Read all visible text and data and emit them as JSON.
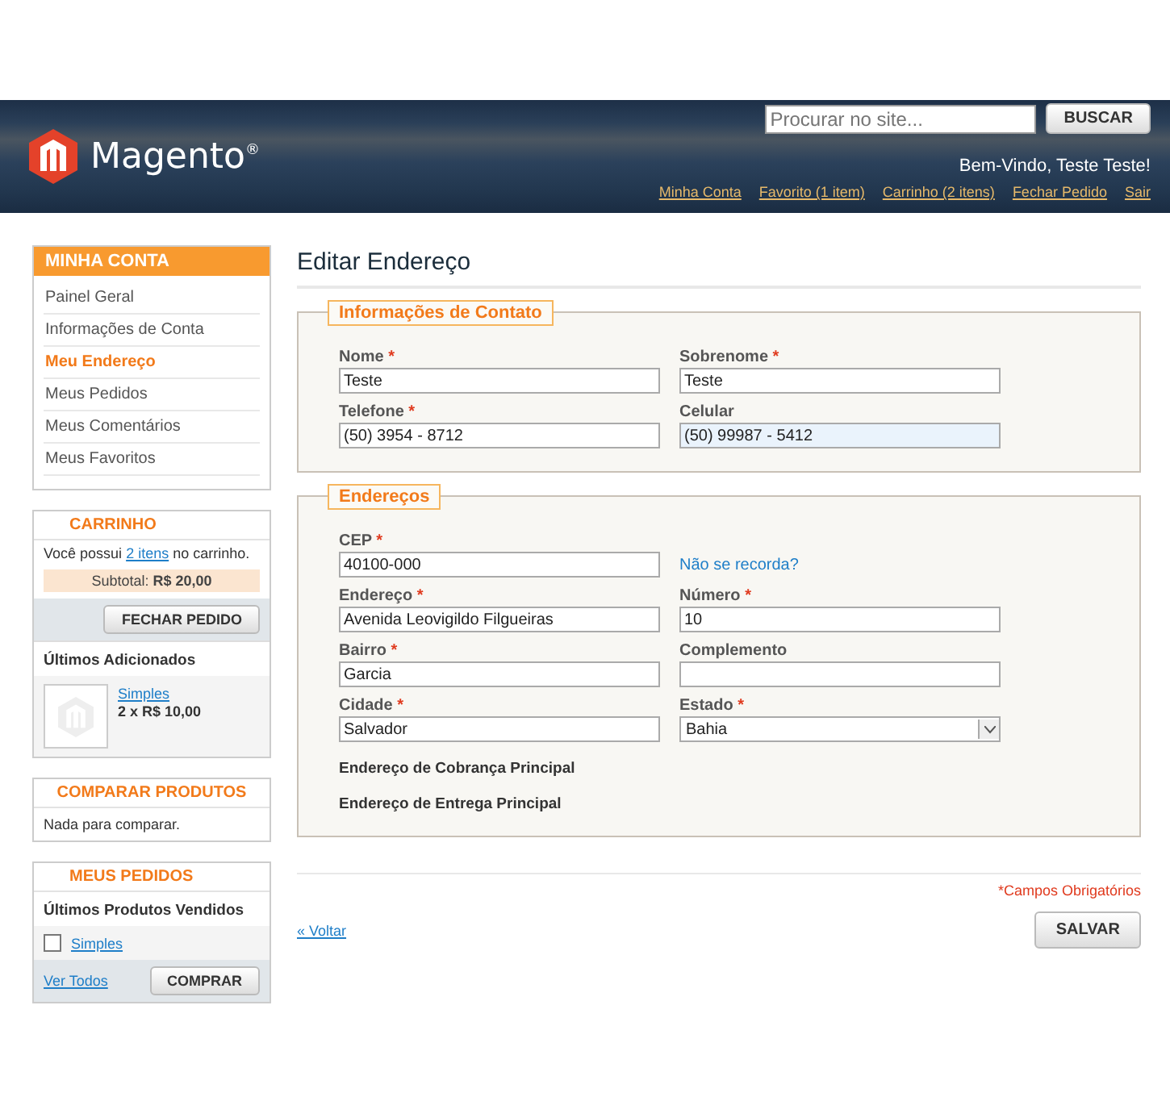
{
  "header": {
    "logo": "Magento$^{®}$",
    "search": {
      "placeholder": "Procurar no site..."
    },
    "search_button": "BUSCAR",
    "welcome": "Bem-Vindo, Teste Teste!",
    "links": [
      "Minha Conta",
      "Favorito (1 item)",
      "Carrinho (2 itens)",
      "Fechar Pedido",
      "Sair"
    ]
  },
  "sidebar": {
    "account": {
      "title": "MINHA CONTA",
      "items": [
        {
          "label": "Painel Geral",
          "selected": false
        },
        {
          "label": "Informações de Conta",
          "selected": false
        },
        {
          "label": "Meu Endereço",
          "selected": true
        },
        {
          "label": "Meus Pedidos",
          "selected": false
        },
        {
          "label": "Meus Comentários",
          "selected": false
        },
        {
          "label": "Meus Favoritos",
          "selected": false
        }
      ]
    },
    "cart": {
      "title": "CARRINHO",
      "intro": "Você possui",
      "link": "2 itens",
      "outro": "no carrinho.",
      "subtotal": "Subtotal: **R$ 20,00**",
      "button": "FECHAR PEDIDO",
      "recent_title": "Últimos Adicionados",
      "items": [
        {
          "name": "Simples",
          "price": "2 x R$ 10,00"
        }
      ]
    },
    "compare": {
      "title": "COMPARAR PRODUTOS",
      "text": "Nada para comparar."
    },
    "orders": {
      "title": "MEUS PEDIDOS",
      "subtitle": "Últimos Produtos Vendidos",
      "items": [
        {
          "name": "Simples",
          "checked": false
        }
      ],
      "link": "Ver Todos",
      "button": "COMPRAR"
    }
  },
  "main": {
    "title": "Editar Endereço",
    "sections": [
      {
        "legend": "Informações de Contato",
        "fields": [
          {
            "kind": "text",
            "label": "Nome",
            "required_mark": "*",
            "value": "Teste"
          },
          {
            "kind": "text",
            "label": "Sobrenome",
            "required_mark": "*",
            "value": "Teste"
          },
          {
            "kind": "text",
            "label": "Telefone",
            "required_mark": "*",
            "value": "(50) 3954 - 8712"
          },
          {
            "kind": "text",
            "label": "Celular",
            "value": "(50) 99987 - 5412",
            "focused": true
          }
        ]
      },
      {
        "legend": "Endereços",
        "fields": [
          {
            "kind": "text",
            "label": "CEP",
            "required_mark": "*",
            "value": "40100-000"
          },
          {
            "kind": "link",
            "text": "Não se recorda?"
          },
          {
            "kind": "text",
            "label": "Endereço",
            "required_mark": "*",
            "value": "Avenida Leovigildo Filgueiras"
          },
          {
            "kind": "text",
            "label": "Número",
            "required_mark": "*",
            "value": "10"
          },
          {
            "kind": "text",
            "label": "Bairro",
            "required_mark": "*",
            "value": "Garcia"
          },
          {
            "kind": "text",
            "label": "Complemento"
          },
          {
            "kind": "text",
            "label": "Cidade",
            "required_mark": "*",
            "value": "Salvador"
          },
          {
            "kind": "select",
            "label": "Estado",
            "required_mark": "*",
            "value": "Bahia"
          },
          {
            "kind": "note",
            "text": "Endereço de Cobrança Principal"
          },
          {
            "kind": "note",
            "text": "Endereço de Entrega Principal"
          }
        ]
      }
    ],
    "required_note": "*Campos Obrigatórios",
    "back_link": "« Voltar",
    "save_button": "SALVAR"
  }
}
